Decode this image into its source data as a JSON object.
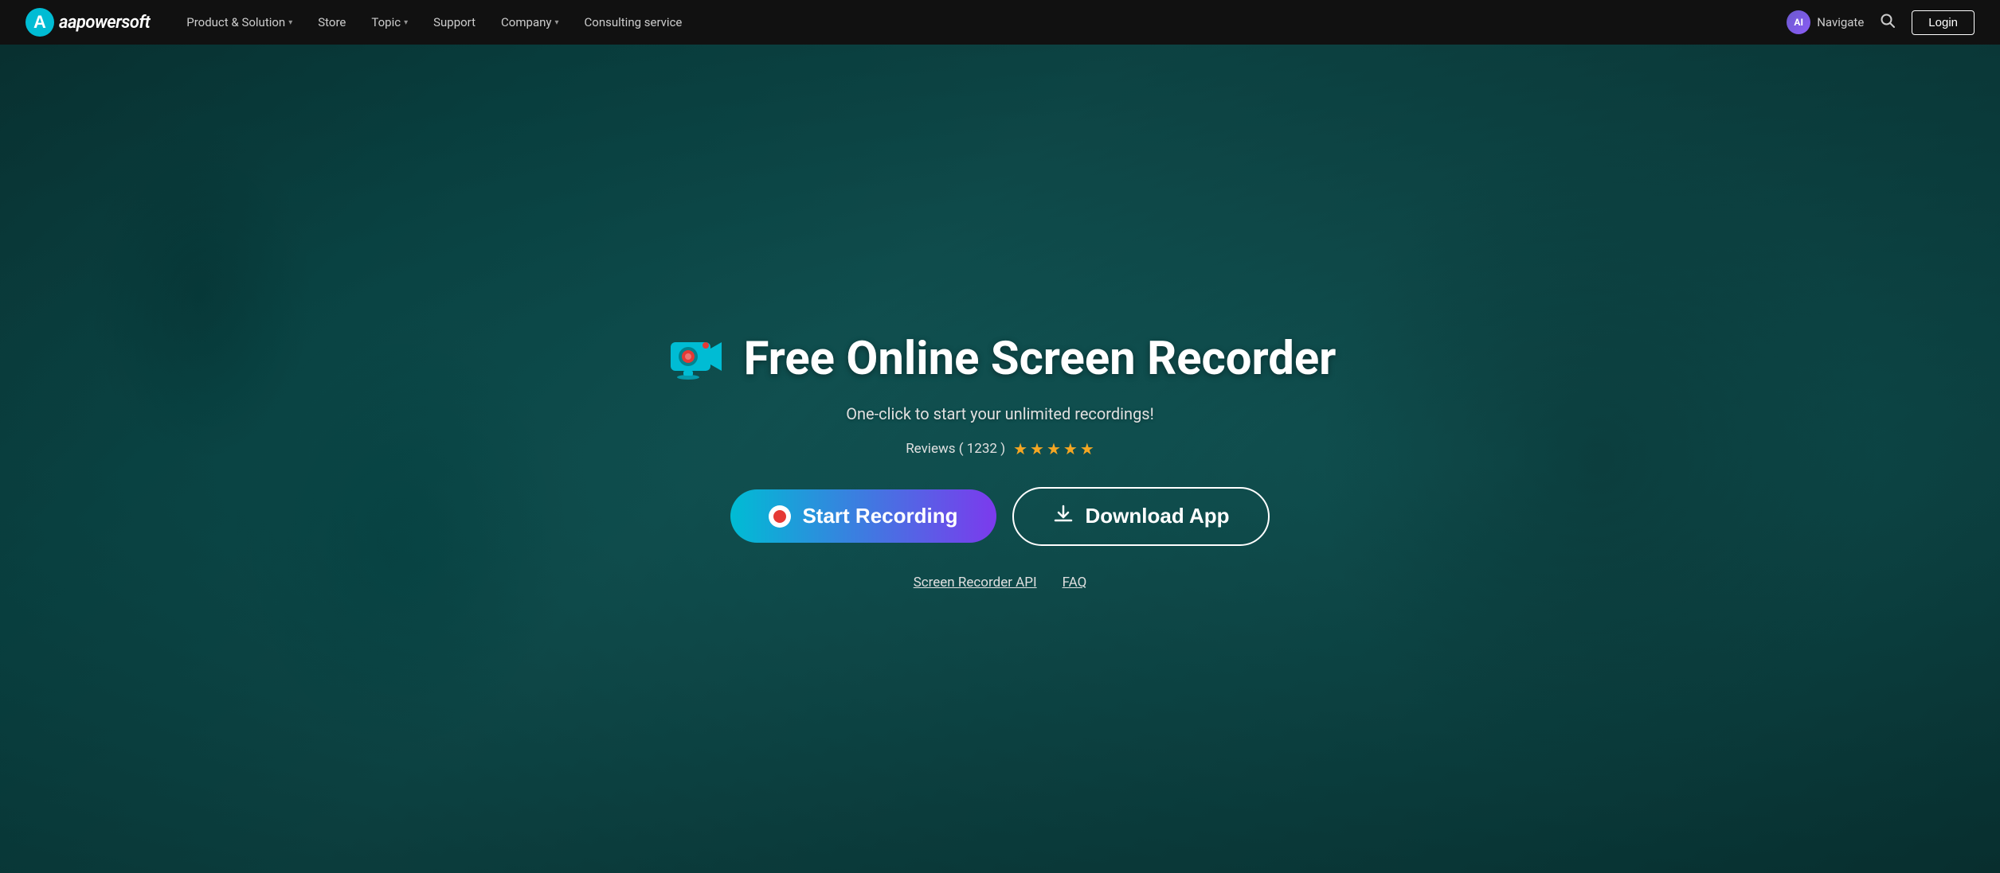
{
  "navbar": {
    "logo_text_a": "a",
    "logo_text_brand": "apowersoft",
    "nav_items": [
      {
        "label": "Product & Solution",
        "has_dropdown": true
      },
      {
        "label": "Store",
        "has_dropdown": false
      },
      {
        "label": "Topic",
        "has_dropdown": true
      },
      {
        "label": "Support",
        "has_dropdown": false
      },
      {
        "label": "Company",
        "has_dropdown": true
      },
      {
        "label": "Consulting service",
        "has_dropdown": false
      }
    ],
    "ai_label": "AI",
    "navigate_label": "Navigate",
    "search_label": "Search",
    "login_label": "Login"
  },
  "hero": {
    "title": "Free Online Screen Recorder",
    "subtitle": "One-click to start your unlimited recordings!",
    "reviews_text": "Reviews ( 1232 )",
    "star_count": 5,
    "btn_start": "Start Recording",
    "btn_download": "Download App",
    "link_api": "Screen Recorder API",
    "link_faq": "FAQ"
  }
}
